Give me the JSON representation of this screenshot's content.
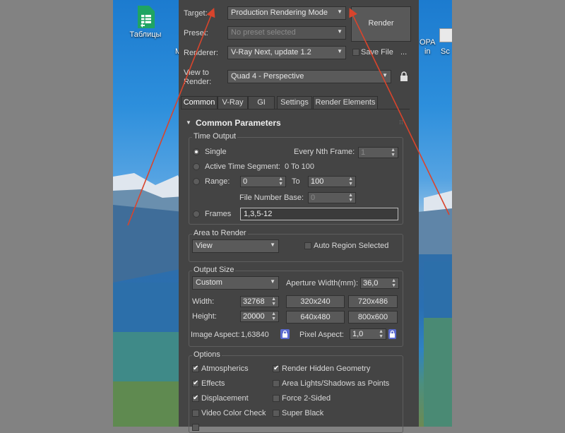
{
  "desktop": {
    "icons": [
      {
        "label": "Таблицы"
      },
      {
        "label": "М"
      },
      {
        "label": "ОРА\nin"
      },
      {
        "label": "Sc"
      }
    ]
  },
  "dialog": {
    "target": {
      "label": "Target:",
      "value": "Production Rendering Mode"
    },
    "preset": {
      "label": "Preset:",
      "value": "No preset selected"
    },
    "renderer": {
      "label": "Renderer:",
      "value": "V-Ray Next, update 1.2"
    },
    "save_file": {
      "label": "Save File",
      "checked": false
    },
    "more_label": "...",
    "view": {
      "label_line1": "View to",
      "label_line2": "Render:",
      "value": "Quad 4 - Perspective"
    },
    "render_button": "Render",
    "tabs": [
      "Common",
      "V-Ray",
      "GI",
      "Settings",
      "Render Elements"
    ],
    "rollout_title": "Common Parameters",
    "time_output": {
      "title": "Time Output",
      "single": "Single",
      "every_nth_label": "Every Nth Frame:",
      "every_nth_value": "1",
      "active_segment": "Active Time Segment:",
      "active_range": "0 To 100",
      "range": "Range:",
      "range_from": "0",
      "to": "To",
      "range_to": "100",
      "file_base_label": "File Number Base:",
      "file_base_value": "0",
      "frames": "Frames",
      "frames_value": "1,3,5-12"
    },
    "area": {
      "title": "Area to Render",
      "value": "View",
      "auto_region": "Auto Region Selected"
    },
    "output_size": {
      "title": "Output Size",
      "preset": "Custom",
      "aperture_label": "Aperture Width(mm):",
      "aperture_value": "36,0",
      "width_label": "Width:",
      "width_value": "32768",
      "height_label": "Height:",
      "height_value": "20000",
      "presets": [
        "320x240",
        "720x486",
        "640x480",
        "800x600"
      ],
      "image_aspect_label": "Image Aspect:",
      "image_aspect_value": "1,63840",
      "pixel_aspect_label": "Pixel Aspect:",
      "pixel_aspect_value": "1,0"
    },
    "options": {
      "title": "Options",
      "atmospherics": "Atmospherics",
      "render_hidden": "Render Hidden Geometry",
      "effects": "Effects",
      "area_lights": "Area Lights/Shadows as Points",
      "displacement": "Displacement",
      "force_2sided": "Force 2-Sided",
      "video_color": "Video Color Check",
      "super_black": "Super Black",
      "check_mark": "✔"
    }
  },
  "colors": {
    "arrow": "#d9442c",
    "lock_blue": "#5b6ad0",
    "panel": "#444444"
  }
}
